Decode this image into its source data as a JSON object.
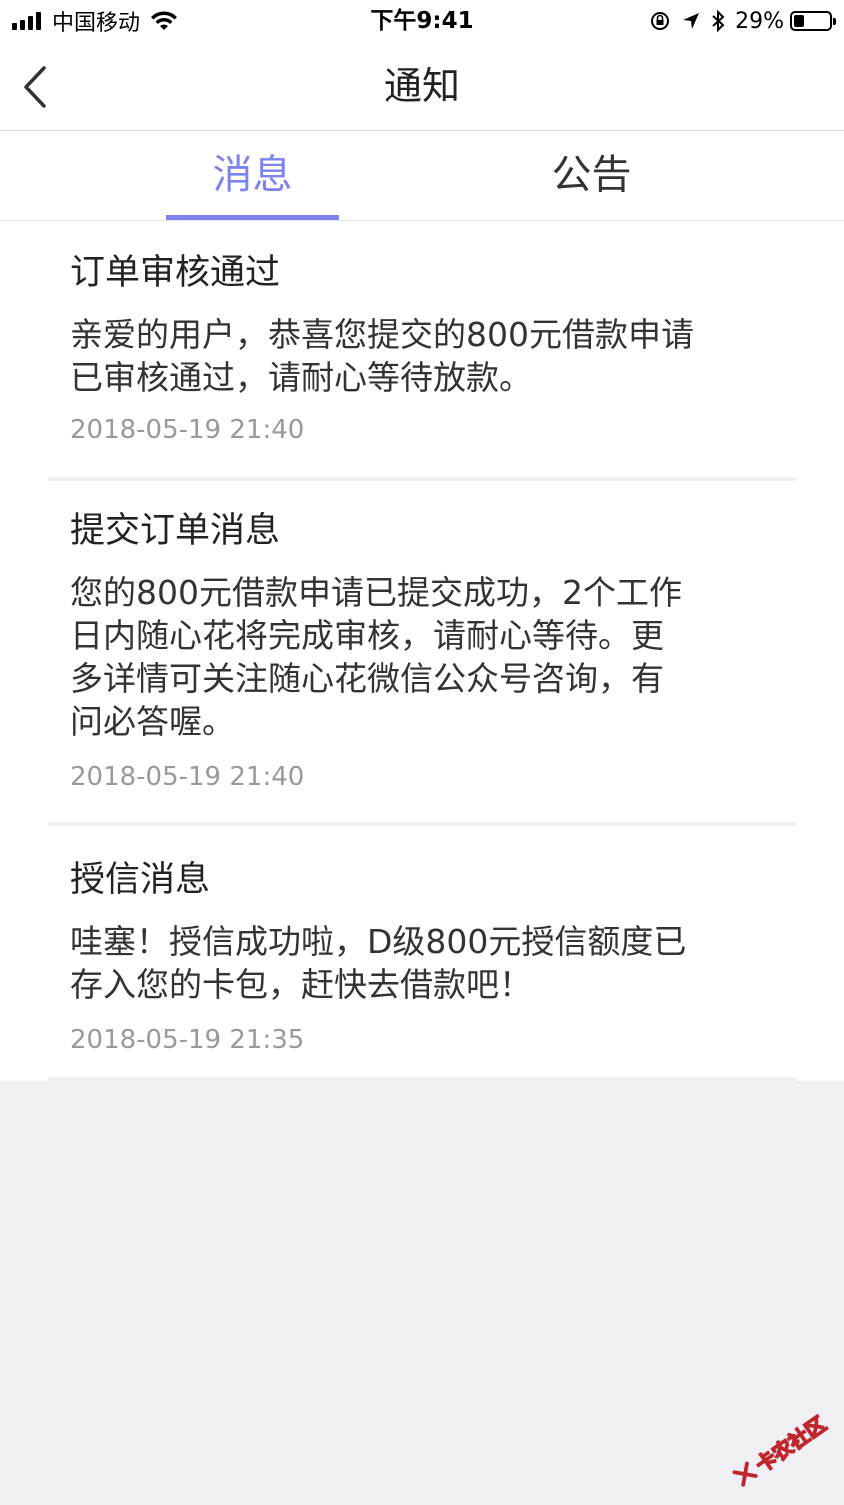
{
  "status_bar": {
    "carrier": "中国移动",
    "time": "下午9:41",
    "battery_percent": "29%",
    "battery_level": 0.29
  },
  "nav": {
    "title": "通知"
  },
  "tabs": [
    {
      "label": "消息",
      "active": true
    },
    {
      "label": "公告",
      "active": false
    }
  ],
  "messages": [
    {
      "title": "订单审核通过",
      "body_lines": [
        "亲爱的用户，恭喜您提交的800元借款申请",
        "已审核通过，请耐心等待放款。"
      ],
      "time": "2018-05-19 21:40"
    },
    {
      "title": "提交订单消息",
      "body_lines": [
        "您的800元借款申请已提交成功，2个工作",
        "日内随心花将完成审核，请耐心等待。更",
        "多详情可关注随心花微信公众号咨询，有",
        "问必答喔。"
      ],
      "time": "2018-05-19 21:40"
    },
    {
      "title": "授信消息",
      "body_lines": [
        "哇塞！授信成功啦，D级800元授信额度已",
        "存入您的卡包，赶快去借款吧！"
      ],
      "time": "2018-05-19 21:35"
    }
  ],
  "watermark": {
    "text": "卡农社区"
  },
  "colors": {
    "accent": "#7c83f0",
    "background": "#efeff4",
    "time_text": "#999999",
    "watermark": "#c0262d"
  }
}
